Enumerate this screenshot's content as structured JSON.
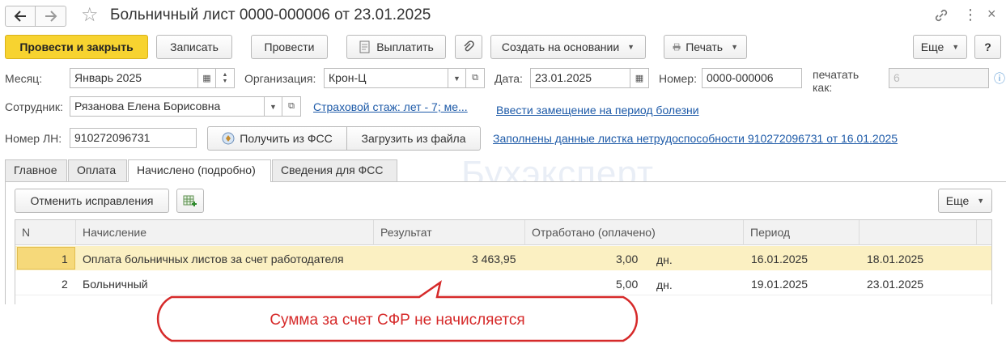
{
  "window": {
    "title": "Больничный лист 0000-000006 от 23.01.2025"
  },
  "toolbar": {
    "post_close": "Провести и закрыть",
    "write": "Записать",
    "post": "Провести",
    "pay": "Выплатить",
    "create_based": "Создать на основании",
    "print": "Печать",
    "more": "Еще",
    "help": "?"
  },
  "form": {
    "month_label": "Месяц:",
    "month_value": "Январь 2025",
    "org_label": "Организация:",
    "org_value": "Крон-Ц",
    "date_label": "Дата:",
    "date_value": "23.01.2025",
    "number_label": "Номер:",
    "number_value": "0000-000006",
    "print_as_label_1": "печатать",
    "print_as_label_2": "как:",
    "print_as_value": "6",
    "employee_label": "Сотрудник:",
    "employee_value": "Рязанова Елена Борисовна",
    "insurance_link": "Страховой стаж: лет - 7; ме...",
    "substitution_link": "Ввести замещение на период болезни",
    "ln_label": "Номер ЛН:",
    "ln_value": "910272096731",
    "get_fss": "Получить из ФСС",
    "load_file": "Загрузить из файла",
    "filled_link": "Заполнены данные листка нетрудоспособности 910272096731 от 16.01.2025"
  },
  "tabs": [
    "Главное",
    "Оплата",
    "Начислено (подробно)",
    "Сведения для ФСС"
  ],
  "watermark": "Бухэксперт",
  "panel": {
    "cancel_fix": "Отменить исправления",
    "more": "Еще"
  },
  "table": {
    "headers": [
      "N",
      "Начисление",
      "Результат",
      "Отработано (оплачено)",
      "Период"
    ],
    "rows": [
      {
        "n": "1",
        "name": "Оплата больничных листов за счет работодателя",
        "result": "3 463,95",
        "worked": "3,00",
        "unit": "дн.",
        "from": "16.01.2025",
        "to": "18.01.2025"
      },
      {
        "n": "2",
        "name": "Больничный",
        "result": "",
        "worked": "5,00",
        "unit": "дн.",
        "from": "19.01.2025",
        "to": "23.01.2025"
      }
    ]
  },
  "callout": {
    "text": "Сумма за счет СФР не начисляется"
  },
  "colors": {
    "primary": "#f7d330",
    "selected_row": "#fbf0c2",
    "link": "#1d5aa8",
    "callout": "#d62a2a"
  }
}
